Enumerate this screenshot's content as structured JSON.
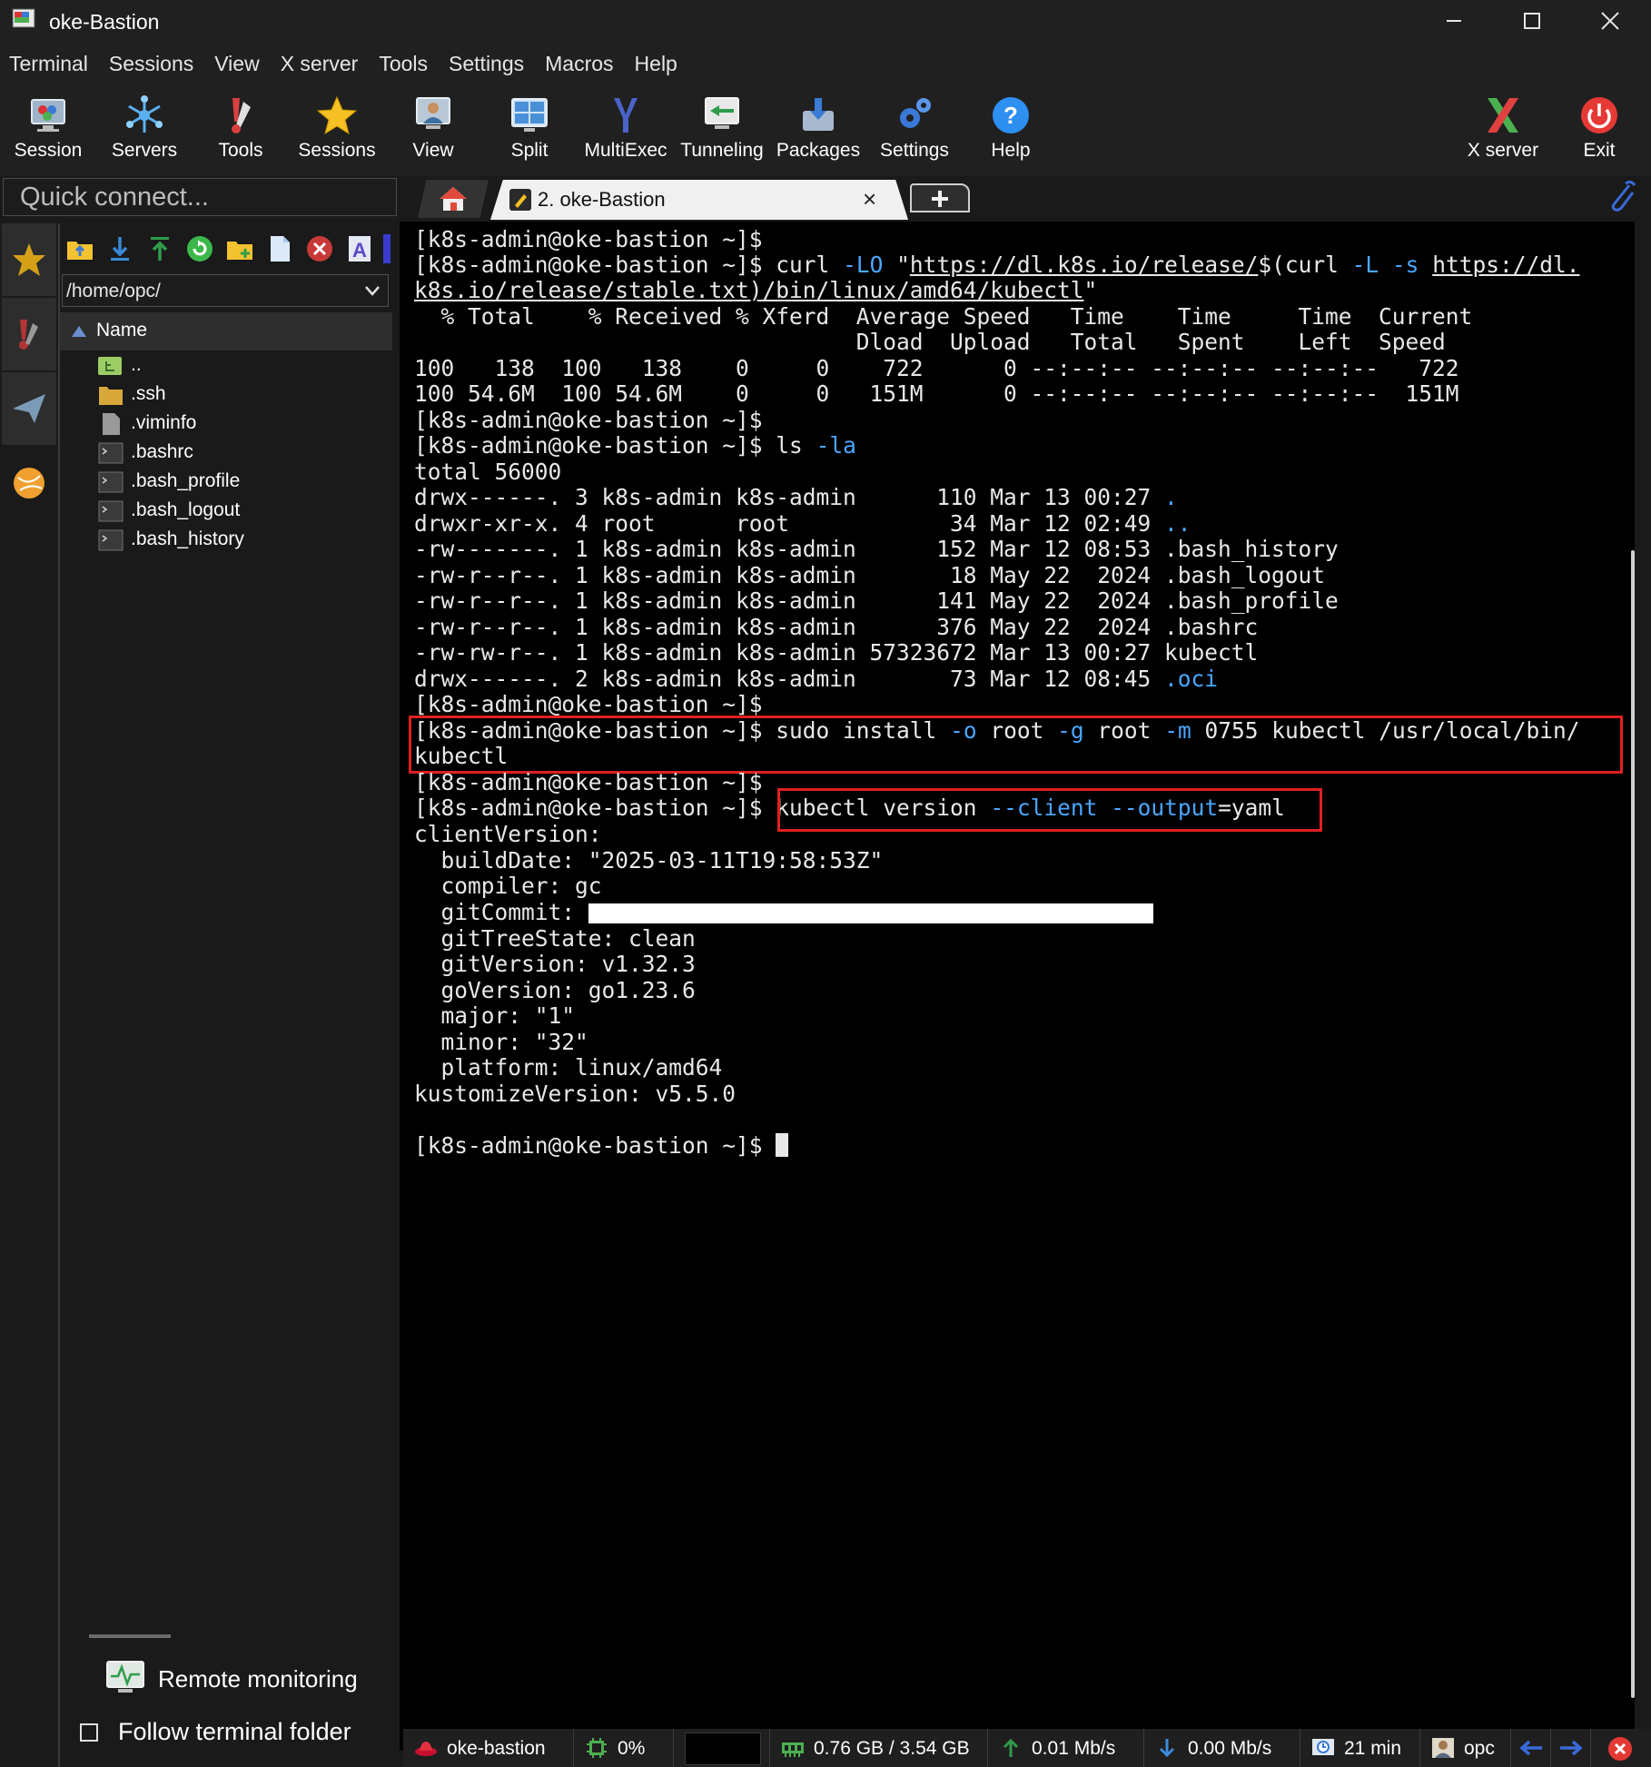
{
  "window": {
    "title": "oke-Bastion"
  },
  "menu": [
    "Terminal",
    "Sessions",
    "View",
    "X server",
    "Tools",
    "Settings",
    "Macros",
    "Help"
  ],
  "toolbar": {
    "session": "Session",
    "servers": "Servers",
    "tools": "Tools",
    "sessions": "Sessions",
    "view": "View",
    "split": "Split",
    "multiexec": "MultiExec",
    "tunneling": "Tunneling",
    "packages": "Packages",
    "settings": "Settings",
    "help": "Help",
    "xserver": "X server",
    "exit": "Exit"
  },
  "quick_connect": {
    "placeholder": "Quick connect..."
  },
  "files": {
    "path": "/home/opc/",
    "header": "Name",
    "items": [
      "..",
      ".ssh",
      ".viminfo",
      ".bashrc",
      ".bash_profile",
      ".bash_logout",
      ".bash_history"
    ]
  },
  "bottom_panel": {
    "remote_monitoring": "Remote monitoring",
    "follow_folder": "Follow terminal folder"
  },
  "tab": {
    "label": "2. oke-Bastion",
    "close": "×"
  },
  "terminal": {
    "prompt": "[k8s-admin@oke-bastion ~]$",
    "curl_cmd": "curl",
    "curl_flag1": "-LO",
    "curl_q": "\"",
    "curl_url_a": "https://dl.k8s.io/release/",
    "curl_sub": "$(curl",
    "curl_flag2": "-L -s",
    "curl_url_b": "https://dl.",
    "curl_url_c": "k8s.io/release/stable.txt)/bin/linux/amd64/kubectl",
    "curl_end": "\"",
    "progress_header1": "  % Total    % Received % Xferd  Average Speed   Time    Time     Time  Current",
    "progress_header2": "                                 Dload  Upload   Total   Spent    Left  Speed",
    "progress_row1": "100   138  100   138    0     0    722      0 --:--:-- --:--:-- --:--:--   722",
    "progress_row2": "100 54.6M  100 54.6M    0     0   151M      0 --:--:-- --:--:-- --:--:--  151M",
    "ls_cmd": "ls",
    "ls_flag": "-la",
    "total": "total 56000",
    "ls_rows": [
      {
        "text": "drwx------. 3 k8s-admin k8s-admin      110 Mar 13 00:27 ",
        "name": "."
      },
      {
        "text": "drwxr-xr-x. 4 root      root            34 Mar 12 02:49 ",
        "name": ".."
      },
      {
        "text": "-rw-------. 1 k8s-admin k8s-admin      152 Mar 12 08:53 ",
        "name": ".bash_history"
      },
      {
        "text": "-rw-r--r--. 1 k8s-admin k8s-admin       18 May 22  2024 ",
        "name": ".bash_logout"
      },
      {
        "text": "-rw-r--r--. 1 k8s-admin k8s-admin      141 May 22  2024 ",
        "name": ".bash_profile"
      },
      {
        "text": "-rw-r--r--. 1 k8s-admin k8s-admin      376 May 22  2024 ",
        "name": ".bashrc"
      },
      {
        "text": "-rw-rw-r--. 1 k8s-admin k8s-admin 57323672 Mar 13 00:27 ",
        "name": "kubectl"
      },
      {
        "text": "drwx------. 2 k8s-admin k8s-admin       73 Mar 12 08:45 ",
        "name": ".oci"
      }
    ],
    "install_a": "sudo install",
    "install_o": "-o",
    "install_b": "root",
    "install_g": "-g",
    "install_c": "root",
    "install_m": "-m",
    "install_d": "0755 kubectl /usr/local/bin/",
    "install_wrap": "kubectl",
    "version_a": "kubectl version",
    "version_flags": "--client --output",
    "version_b": "=yaml",
    "yaml": [
      "clientVersion:",
      "  buildDate: \"2025-03-11T19:58:53Z\"",
      "  compiler: gc",
      "  gitCommit: ",
      "  gitTreeState: clean",
      "  gitVersion: v1.32.3",
      "  goVersion: go1.23.6",
      "  major: \"1\"",
      "  minor: \"32\"",
      "  platform: linux/amd64",
      "kustomizeVersion: v5.5.0"
    ]
  },
  "status": {
    "host": "oke-bastion",
    "cpu": "0%",
    "memory": "0.76 GB / 3.54 GB",
    "upload": "0.01 Mb/s",
    "download": "0.00 Mb/s",
    "uptime": "21 min",
    "user": "opc"
  },
  "colors": {
    "highlight_box": "#e02020",
    "terminal_cyan": "#4aa6ff",
    "terminal_bg": "#000000"
  }
}
